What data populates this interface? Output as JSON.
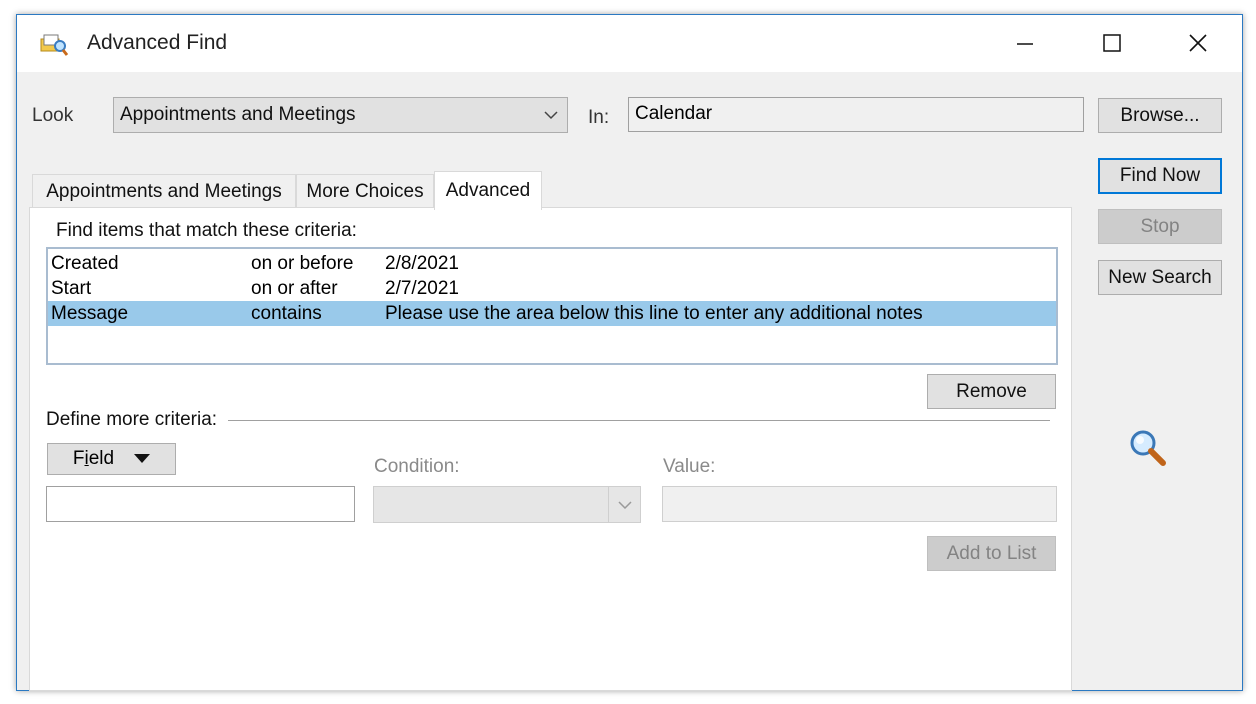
{
  "window": {
    "title": "Advanced Find",
    "controls": {
      "minimize": "—",
      "maximize": "☐",
      "close": "✕"
    }
  },
  "look": {
    "label": "Look",
    "selected": "Appointments and Meetings"
  },
  "in": {
    "label": "In:",
    "value": "Calendar"
  },
  "buttons": {
    "browse": "Browse...",
    "find_now": "Find Now",
    "stop": "Stop",
    "new_search": "New Search"
  },
  "tabs": [
    {
      "label": "Appointments and Meetings",
      "active": false
    },
    {
      "label": "More Choices",
      "active": false
    },
    {
      "label": "Advanced",
      "active": true
    }
  ],
  "criteria": {
    "heading": "Find items that match these criteria:",
    "rows": [
      {
        "field": "Created",
        "condition": "on or before",
        "value": "2/8/2021",
        "selected": false
      },
      {
        "field": "Start",
        "condition": "on or after",
        "value": "2/7/2021",
        "selected": false
      },
      {
        "field": "Message",
        "condition": "contains",
        "value": "Please use the area below this line to enter any additional notes",
        "selected": true
      }
    ],
    "remove_label": "Remove"
  },
  "define": {
    "heading": "Define more criteria:",
    "field_button": "Field",
    "field_button_accel": "i",
    "condition_label": "Condition:",
    "value_label": "Value:",
    "add_to_list": "Add to List"
  },
  "colors": {
    "accent": "#0078d7",
    "selection": "#99c9ea",
    "window_border": "#2b79c2"
  },
  "icons": [
    "advanced-find-app-icon",
    "chevron-down-icon",
    "dropdown-arrow-icon",
    "magnifier-icon"
  ]
}
